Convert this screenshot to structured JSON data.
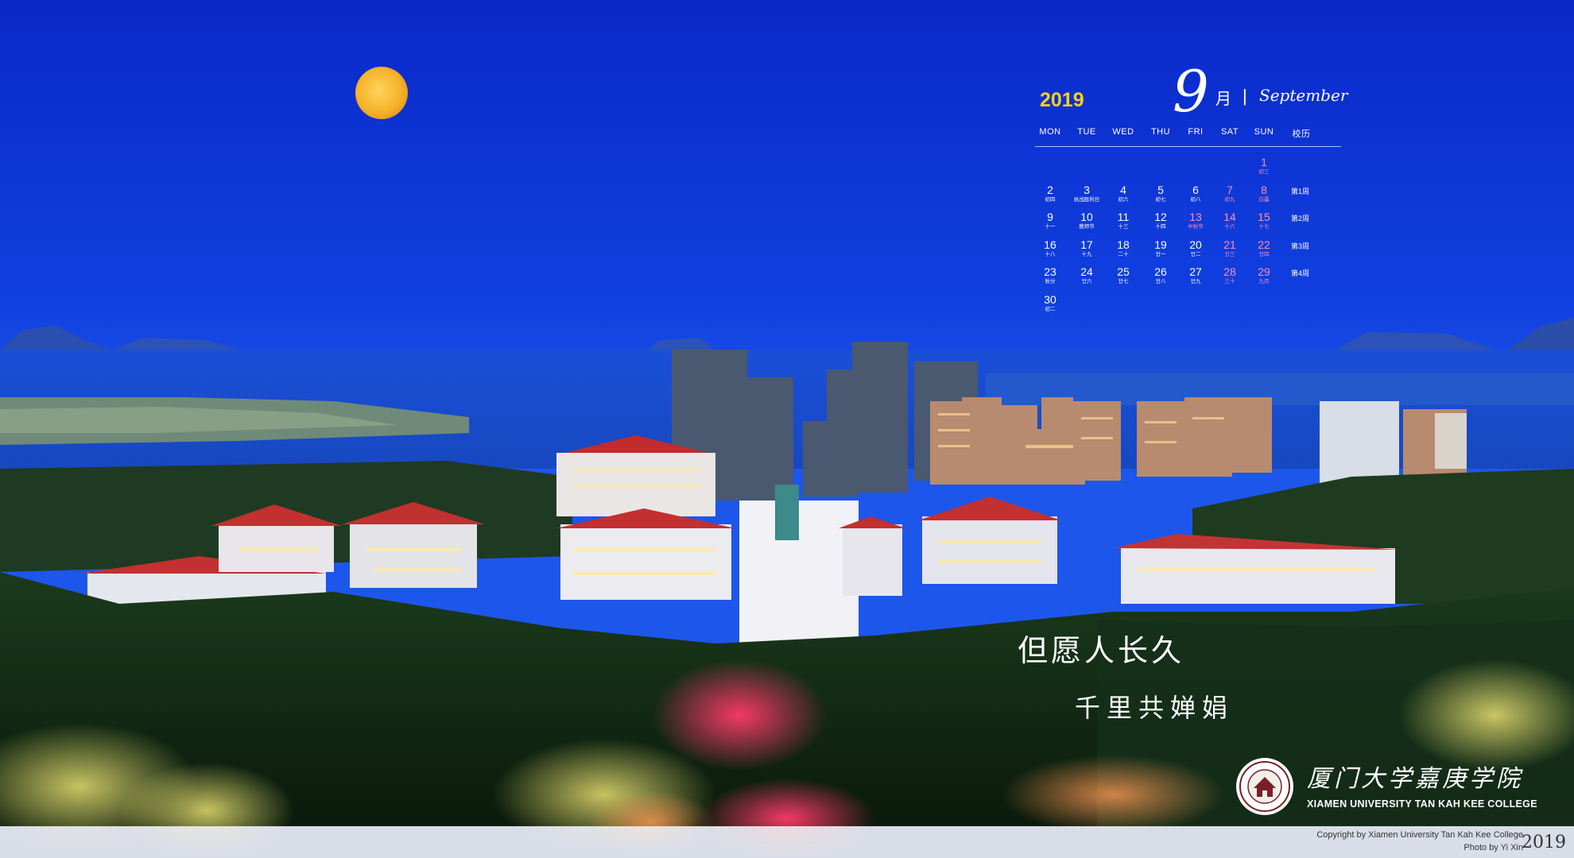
{
  "calendar": {
    "year": "2019",
    "month_num": "9",
    "month_cn": "月",
    "separator": "|",
    "month_en": "September",
    "headers": [
      "MON",
      "TUE",
      "WED",
      "THU",
      "FRI",
      "SAT",
      "SUN",
      "校历"
    ],
    "rows": [
      [
        null,
        null,
        null,
        null,
        null,
        null,
        {
          "d": "1",
          "l": "初三"
        }
      ],
      [
        {
          "d": "2",
          "l": "初四"
        },
        {
          "d": "3",
          "l": "抗战胜利日"
        },
        {
          "d": "4",
          "l": "初六"
        },
        {
          "d": "5",
          "l": "初七"
        },
        {
          "d": "6",
          "l": "初八"
        },
        {
          "d": "7",
          "l": "初九"
        },
        {
          "d": "8",
          "l": "白露"
        }
      ],
      [
        {
          "d": "9",
          "l": "十一"
        },
        {
          "d": "10",
          "l": "教师节"
        },
        {
          "d": "11",
          "l": "十三"
        },
        {
          "d": "12",
          "l": "十四"
        },
        {
          "d": "13",
          "l": "中秋节"
        },
        {
          "d": "14",
          "l": "十六"
        },
        {
          "d": "15",
          "l": "十七"
        }
      ],
      [
        {
          "d": "16",
          "l": "十八"
        },
        {
          "d": "17",
          "l": "十九"
        },
        {
          "d": "18",
          "l": "二十"
        },
        {
          "d": "19",
          "l": "廿一"
        },
        {
          "d": "20",
          "l": "廿二"
        },
        {
          "d": "21",
          "l": "廿三"
        },
        {
          "d": "22",
          "l": "廿四"
        }
      ],
      [
        {
          "d": "23",
          "l": "秋分"
        },
        {
          "d": "24",
          "l": "廿六"
        },
        {
          "d": "25",
          "l": "廿七"
        },
        {
          "d": "26",
          "l": "廿八"
        },
        {
          "d": "27",
          "l": "廿九"
        },
        {
          "d": "28",
          "l": "三十"
        },
        {
          "d": "29",
          "l": "九月"
        }
      ],
      [
        {
          "d": "30",
          "l": "初二"
        },
        null,
        null,
        null,
        null,
        null,
        null
      ]
    ],
    "weeks": [
      "",
      "第1周",
      "第2周",
      "第3周",
      "第4周",
      ""
    ]
  },
  "poem": {
    "line1": "但愿人长久",
    "line2": "千里共婵娟"
  },
  "college": {
    "name_cn": "厦门大学嘉庚学院",
    "name_en": "XIAMEN UNIVERSITY TAN KAH KEE COLLEGE"
  },
  "footer": {
    "copyright": "Copyright by Xiamen University Tan Kah Kee College",
    "photo": "Photo by Yi Xin",
    "year": "2019"
  },
  "colors": {
    "sky": "#0a2fd0",
    "year_gold": "#ffd11a",
    "weekend_pink": "#ff8fb4"
  }
}
